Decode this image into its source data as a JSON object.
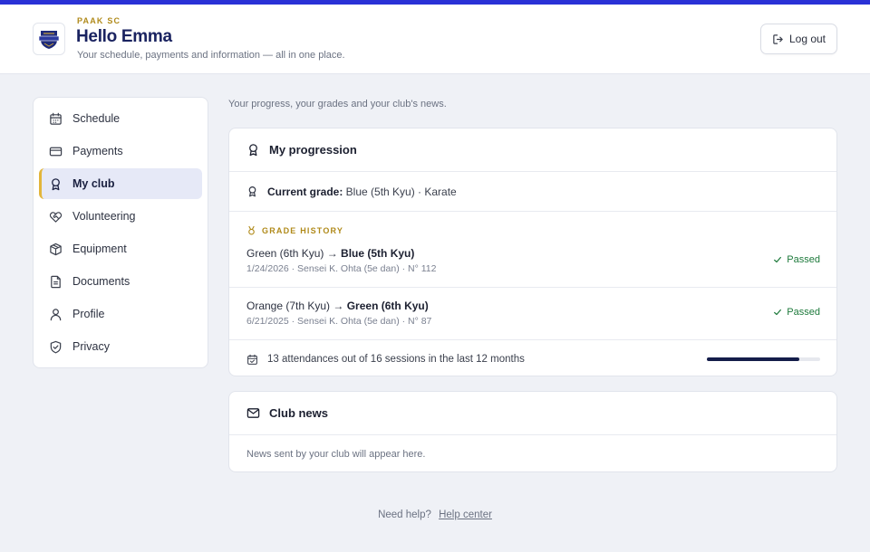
{
  "header": {
    "club_name": "PAAK SC",
    "greeting": "Hello Emma",
    "tagline": "Your schedule, payments and information — all in one place.",
    "logout_label": "Log out"
  },
  "accent_colors": {
    "brand": "#2a31d6",
    "gold": "#b08a1a",
    "navy": "#1a2360",
    "success": "#1e7a3c"
  },
  "sidebar": {
    "items": [
      {
        "label": "Schedule",
        "icon": "calendar-icon",
        "active": false
      },
      {
        "label": "Payments",
        "icon": "credit-card-icon",
        "active": false
      },
      {
        "label": "My club",
        "icon": "award-ribbon-icon",
        "active": true
      },
      {
        "label": "Volunteering",
        "icon": "heart-handshake-icon",
        "active": false
      },
      {
        "label": "Equipment",
        "icon": "box-icon",
        "active": false
      },
      {
        "label": "Documents",
        "icon": "document-icon",
        "active": false
      },
      {
        "label": "Profile",
        "icon": "user-icon",
        "active": false
      },
      {
        "label": "Privacy",
        "icon": "shield-check-icon",
        "active": false
      }
    ]
  },
  "main": {
    "intro": "Your progress, your grades and your club's news.",
    "progression": {
      "title": "My progression",
      "current_grade_label": "Current grade:",
      "current_grade_value": " Blue (5th Kyu) · Karate",
      "history_label": "GRADE HISTORY",
      "history": [
        {
          "from": "Green (6th Kyu) → ",
          "to": "Blue (5th Kyu)",
          "meta": "1/24/2026 · Sensei K. Ohta (5e dan) · N° 112",
          "status": "Passed"
        },
        {
          "from": "Orange (7th Kyu) → ",
          "to": "Green (6th Kyu)",
          "meta": "6/21/2025 · Sensei K. Ohta (5e dan) · N° 87",
          "status": "Passed"
        }
      ],
      "attendance_text": "13 attendances out of 16 sessions in the last 12 months",
      "attendance_fraction": 0.8125
    },
    "news": {
      "title": "Club news",
      "empty_text": "News sent by your club will appear here."
    }
  },
  "footer": {
    "help_text": "Need help?",
    "help_link": "Help center"
  }
}
